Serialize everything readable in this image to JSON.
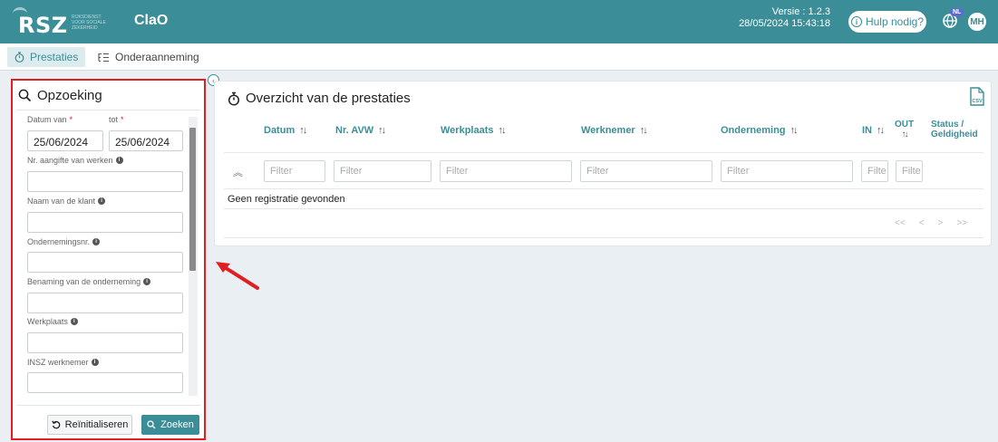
{
  "header": {
    "logo_text": "RSZ",
    "logo_subtext": "RIJKSDIENST VOOR SOCIALE ZEKERHEID",
    "app_title": "ClaO",
    "version_label": "Versie : 1.2.3",
    "version_datetime": "28/05/2024 15:43:18",
    "help_label": "Hulp nodig?",
    "language": "NL",
    "user_initials": "MH"
  },
  "tabs": [
    {
      "label": "Prestaties",
      "icon": "stopwatch-icon",
      "active": true
    },
    {
      "label": "Onderaanneming",
      "icon": "list-tree-icon",
      "active": false
    }
  ],
  "search": {
    "title": "Opzoeking",
    "date_from_label": "Datum van",
    "date_to_label": "tot",
    "date_from_value": "25/06/2024",
    "date_to_value": "25/06/2024",
    "works_label": "Nr. aangifte van werken",
    "client_label": "Naam van de klant",
    "company_nr_label": "Ondernemingsnr.",
    "company_name_label": "Benaming van de onderneming",
    "workplace_label": "Werkplaats",
    "insz_label": "INSZ werknemer",
    "reset_label": "Reïnitialiseren",
    "search_label": "Zoeken",
    "required_mark": "*"
  },
  "overview": {
    "title": "Overzicht van de prestaties",
    "csv_label": "CSV",
    "columns": [
      "Datum",
      "Nr. AVW",
      "Werkplaats",
      "Werknemer",
      "Onderneming",
      "IN",
      "OUT",
      "Status /",
      "Geldigheid"
    ],
    "filter_placeholder": "Filter",
    "narrow_filter_text": "Filte",
    "empty_message": "Geen registratie gevonden",
    "pager": [
      "<<",
      "<",
      ">",
      ">>"
    ]
  },
  "colors": {
    "primary": "#3b8e97",
    "highlight_border": "#e02020",
    "background": "#e9eff2"
  }
}
